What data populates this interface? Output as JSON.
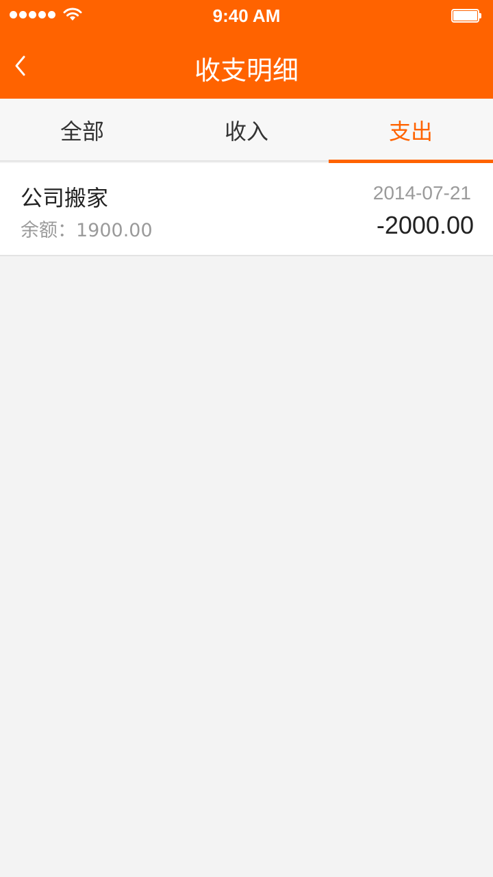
{
  "status_bar": {
    "time": "9:40 AM",
    "signal_bars": 5,
    "wifi_icon": "wifi-icon",
    "battery_icon": "battery-icon",
    "battery_level": 1.0
  },
  "header": {
    "title": "收支明细",
    "back_icon": "chevron-left-icon",
    "color": "#ff6300"
  },
  "tabs": [
    {
      "label": "全部",
      "active": false
    },
    {
      "label": "收入",
      "active": false
    },
    {
      "label": "支出",
      "active": true
    }
  ],
  "transactions": [
    {
      "name": "公司搬家",
      "balance_label": "余额：",
      "balance": "1900.00",
      "date": "2014-07-21",
      "amount": "-2000.00"
    }
  ],
  "colors": {
    "accent": "#ff6300",
    "background": "#f3f3f3",
    "text_primary": "#222222",
    "text_secondary": "#9a9a9a"
  }
}
